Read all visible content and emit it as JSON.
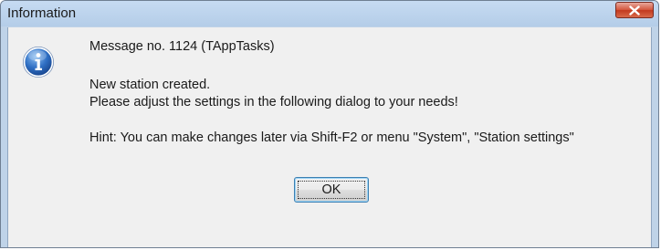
{
  "window": {
    "title": "Information",
    "close_icon": "close-icon"
  },
  "message": {
    "icon": "info-icon",
    "number_line": "Message no. 1124 (TAppTasks)",
    "line1": "New station created.",
    "line2": "Please adjust the settings in the following dialog to your needs!",
    "hint": "Hint: You can make changes later via Shift-F2 or menu \"System\", \"Station settings\""
  },
  "buttons": {
    "ok_label": "OK"
  },
  "colors": {
    "title_bar": "#bfd3e8",
    "close_button": "#c7432a",
    "info_icon": "#2a65b8",
    "dialog_body": "#f0f0f0"
  }
}
